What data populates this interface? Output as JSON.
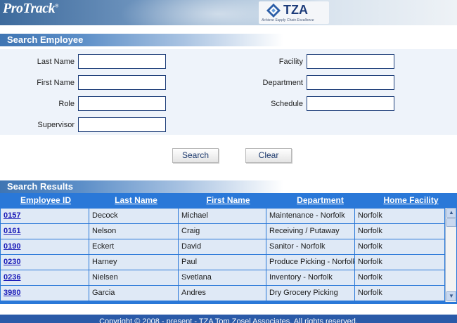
{
  "header": {
    "brand": "ProTrack",
    "brand_mark": "®",
    "partner_logo_text": "TZA",
    "partner_tagline": "Achieve Supply Chain Excellence"
  },
  "search": {
    "title": "Search Employee",
    "fields": {
      "last_name": {
        "label": "Last Name",
        "value": ""
      },
      "first_name": {
        "label": "First Name",
        "value": ""
      },
      "role": {
        "label": "Role",
        "value": ""
      },
      "supervisor": {
        "label": "Supervisor",
        "value": ""
      },
      "facility": {
        "label": "Facility",
        "value": ""
      },
      "department": {
        "label": "Department",
        "value": ""
      },
      "schedule": {
        "label": "Schedule",
        "value": ""
      }
    },
    "search_button": "Search",
    "clear_button": "Clear"
  },
  "results": {
    "title": "Search Results",
    "columns": [
      "Employee ID",
      "Last Name",
      "First Name",
      "Department",
      "Home Facility"
    ],
    "rows": [
      {
        "id": "0157",
        "last": "Decock",
        "first": "Michael",
        "dept": "Maintenance - Norfolk",
        "facility": "Norfolk"
      },
      {
        "id": "0161",
        "last": "Nelson",
        "first": "Craig",
        "dept": "Receiving / Putaway",
        "facility": "Norfolk"
      },
      {
        "id": "0190",
        "last": "Eckert",
        "first": "David",
        "dept": "Sanitor - Norfolk",
        "facility": "Norfolk"
      },
      {
        "id": "0230",
        "last": "Harney",
        "first": "Paul",
        "dept": "Produce Picking - Norfolk",
        "facility": "Norfolk"
      },
      {
        "id": "0236",
        "last": "Nielsen",
        "first": "Svetlana",
        "dept": "Inventory - Norfolk",
        "facility": "Norfolk"
      },
      {
        "id": "3980",
        "last": "Garcia",
        "first": "Andres",
        "dept": "Dry Grocery Picking",
        "facility": "Norfolk"
      }
    ]
  },
  "footer": {
    "text": "Copyright © 2008 - present - TZA Tom Zosel Associates. All rights reserved."
  },
  "colors": {
    "header_blue": "#2a78d8",
    "link_blue": "#1b1bb8",
    "field_border": "#1f3f7a"
  }
}
